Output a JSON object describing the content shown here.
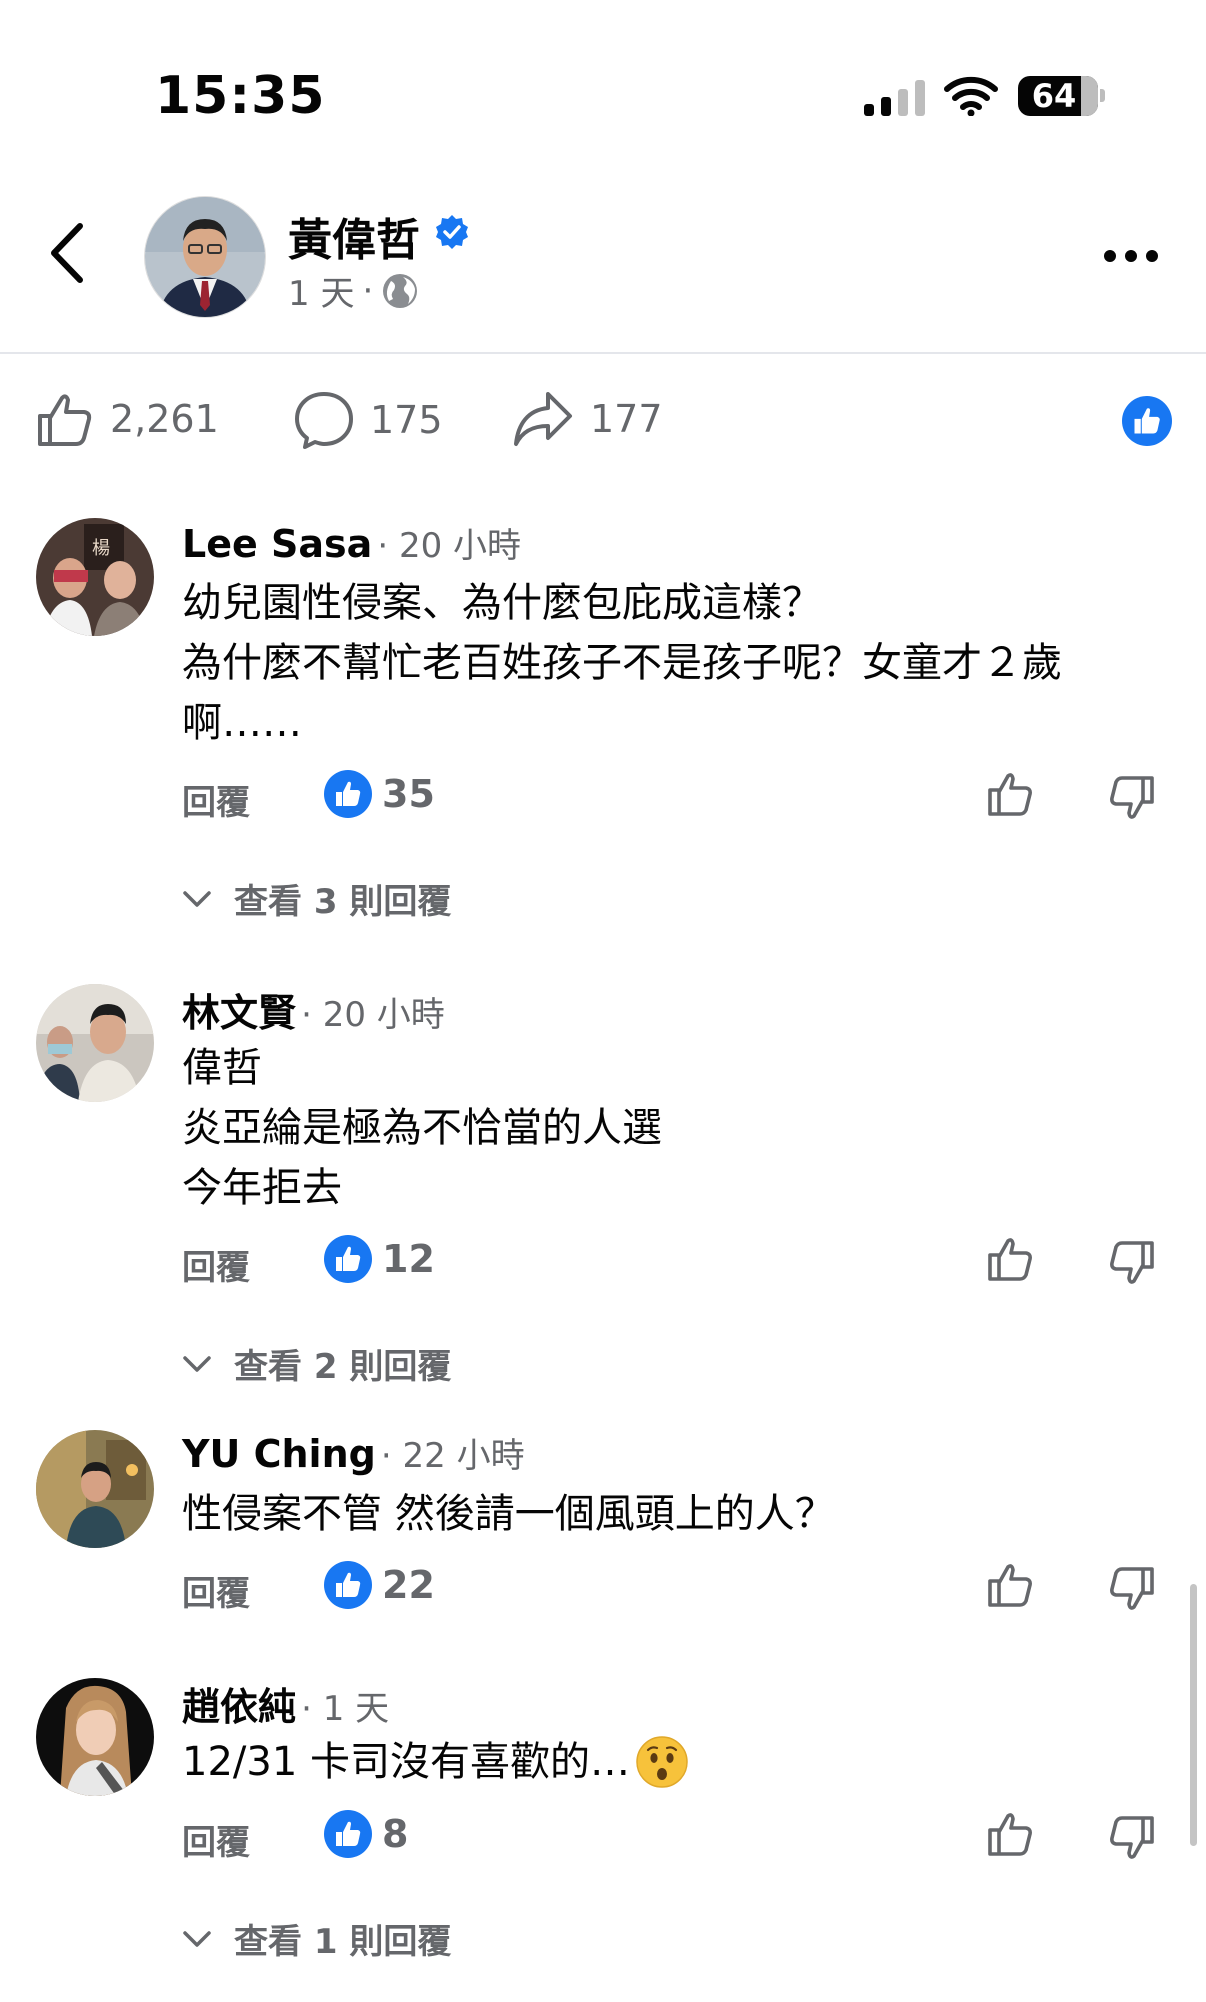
{
  "status_bar": {
    "time": "15:35",
    "battery": "64"
  },
  "post": {
    "author": "黃偉哲",
    "age": "1 天",
    "dot": "·",
    "stats": {
      "likes": "2,261",
      "comments": "175",
      "shares": "177"
    }
  },
  "comments": [
    {
      "name": "Lee Sasa",
      "time": "20 小時",
      "lines": [
        "幼兒園性侵案、為什麼包庇成這樣？",
        "為什麼不幫忙老百姓孩子不是孩子呢？女童才２歲",
        "啊……"
      ],
      "reply": "回覆",
      "likes": "35",
      "view_replies": "查看 3 則回覆"
    },
    {
      "name": "林文賢",
      "time": "20 小時",
      "lines": [
        "偉哲",
        "炎亞綸是極為不恰當的人選",
        "今年拒去"
      ],
      "reply": "回覆",
      "likes": "12",
      "view_replies": "查看 2 則回覆"
    },
    {
      "name": "YU Ching",
      "time": "22 小時",
      "lines": [
        "性侵案不管 然後請一個風頭上的人？"
      ],
      "reply": "回覆",
      "likes": "22",
      "view_replies": ""
    },
    {
      "name": "趙依純",
      "time": "1 天",
      "lines": [
        "12/31 卡司沒有喜歡的…"
      ],
      "reply": "回覆",
      "likes": "8",
      "view_replies": "查看 1 則回覆"
    }
  ],
  "colors": {
    "brand_blue": "#1877f2",
    "secondary_text": "#65676b",
    "divider": "#e4e6eb"
  },
  "icons": [
    "chevron-left-icon",
    "verified-badge-icon",
    "globe-icon",
    "more-icon",
    "like-icon",
    "comment-icon",
    "share-icon",
    "thumbs-up-icon",
    "thumbs-down-icon",
    "chevron-down-icon",
    "hushed-face-emoji"
  ]
}
